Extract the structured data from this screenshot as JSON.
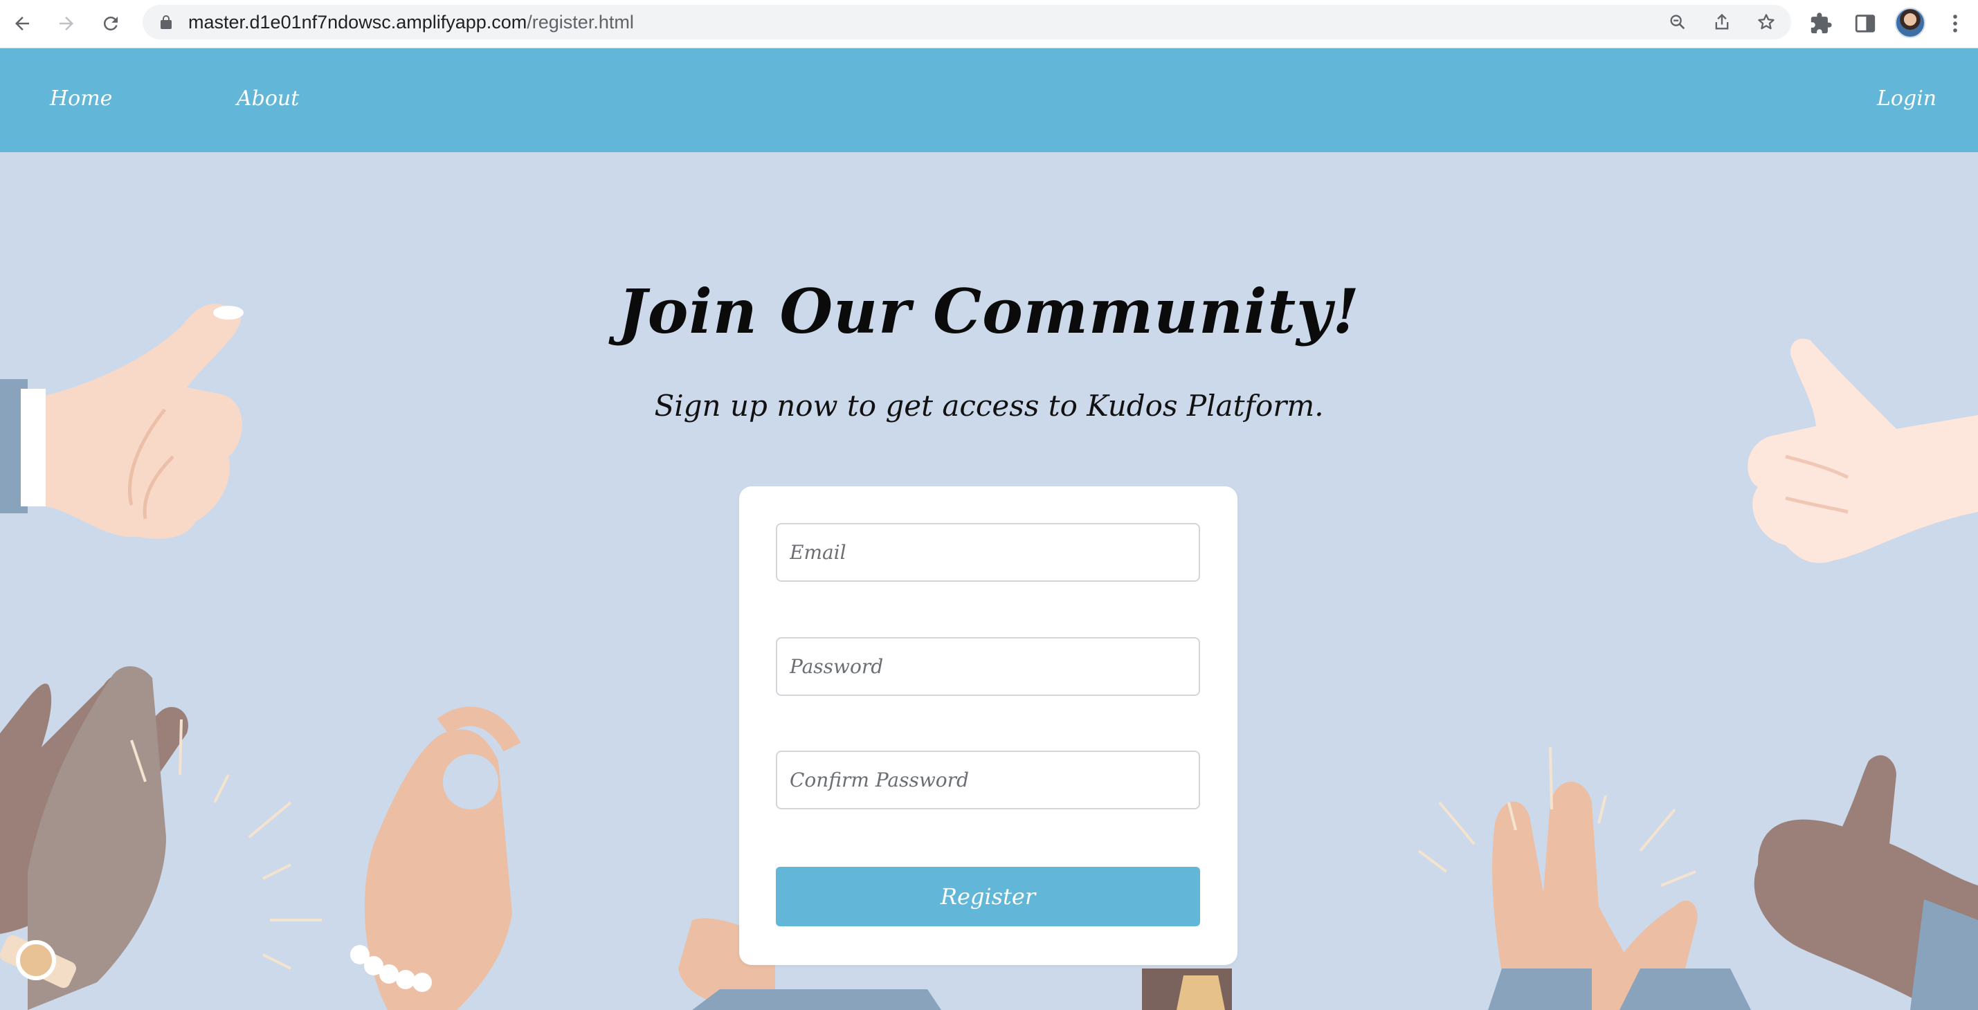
{
  "browser": {
    "url_host": "master.d1e01nf7ndowsc.amplifyapp.com",
    "url_path": "/register.html",
    "icons": [
      "back-icon",
      "forward-icon",
      "reload-icon",
      "lock-icon",
      "zoom-icon",
      "share-icon",
      "star-icon",
      "extensions-icon",
      "side-panel-icon",
      "avatar",
      "more-icon"
    ]
  },
  "nav": {
    "home": "Home",
    "about": "About",
    "login": "Login"
  },
  "hero": {
    "title": "Join Our Community!",
    "subtitle": "Sign up now to get access to Kudos Platform."
  },
  "form": {
    "email_placeholder": "Email",
    "password_placeholder": "Password",
    "confirm_placeholder": "Confirm Password",
    "submit_label": "Register"
  },
  "colors": {
    "nav_bg": "#62b6d7",
    "hero_bg": "#ccd9ea",
    "button_bg": "#62b6d7",
    "card_bg": "#ffffff"
  }
}
